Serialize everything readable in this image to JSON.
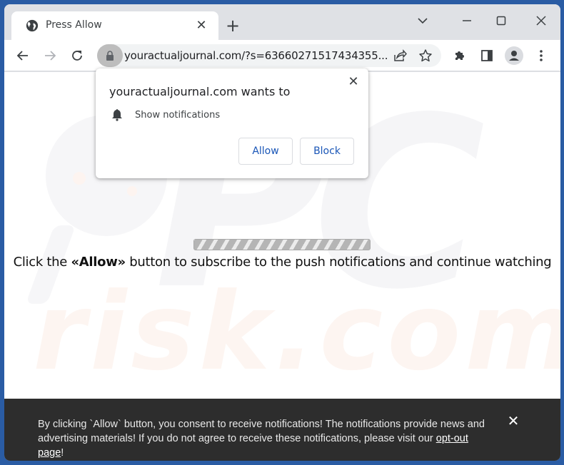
{
  "browser": {
    "tab": {
      "title": "Press Allow",
      "favicon": "globe-icon",
      "close_glyph": "✕"
    },
    "new_tab_glyph": "+",
    "window_controls": [
      "chevron-down-icon",
      "minimize-icon",
      "maximize-icon",
      "close-icon"
    ],
    "toolbar": {
      "back": "back-arrow-icon",
      "forward": "forward-arrow-icon",
      "reload": "reload-icon",
      "url": "youractualjournal.com/?s=63660271517434355...",
      "right_icons": [
        "share-icon",
        "star-icon",
        "extensions-icon",
        "side-panel-icon",
        "profile-icon",
        "menu-icon"
      ]
    }
  },
  "permission_popup": {
    "title": "youractualjournal.com wants to",
    "permission": "Show notifications",
    "close_glyph": "✕",
    "allow_label": "Allow",
    "block_label": "Block"
  },
  "page": {
    "message_prefix": "Click the ",
    "message_bold": "«Allow»",
    "message_suffix": " button to subscribe to the push notifications and continue watching",
    "watermark_top": "PC",
    "watermark_bottom": "risk.com"
  },
  "banner": {
    "text_before_link": "By clicking `Allow` button, you consent to receive notifications! The notifications provide news and advertising materials! If you do not agree to receive these notifications, please visit our ",
    "link_text": "opt-out page",
    "text_after_link": "!",
    "close_glyph": "✕"
  },
  "colors": {
    "desktop": "#2a5ca4",
    "popup_button_text": "#1a56b7",
    "banner_bg": "#2d2d2d"
  }
}
